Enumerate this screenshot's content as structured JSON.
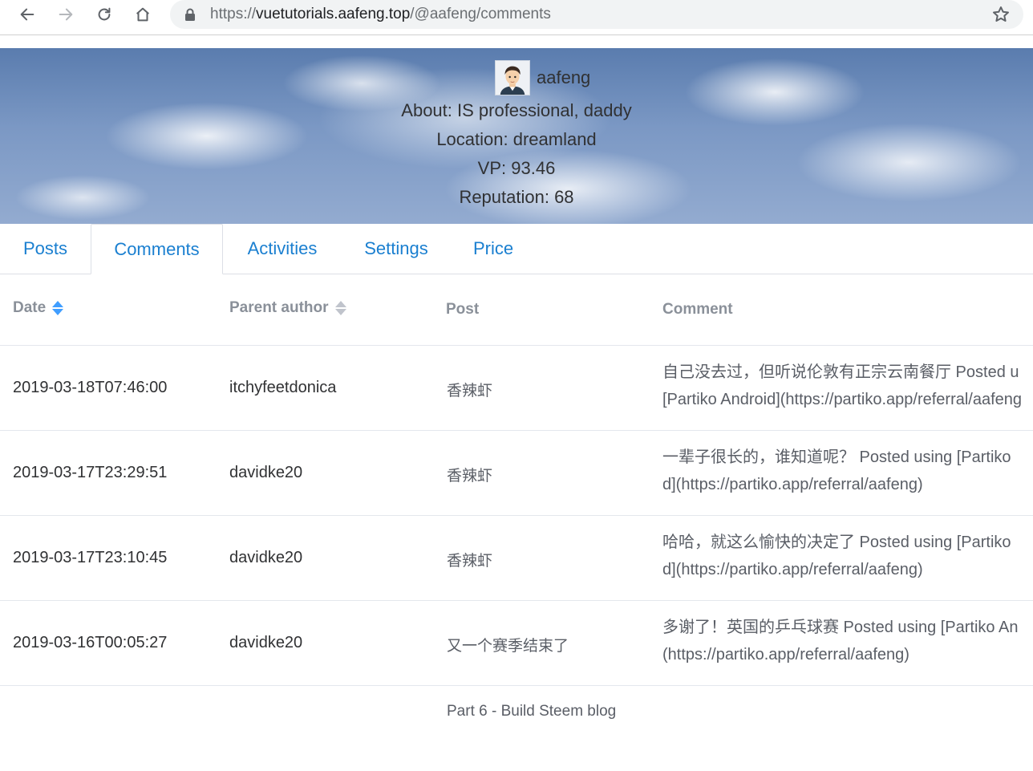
{
  "browser": {
    "url_protocol": "https://",
    "url_host": "vuetutorials.aafeng.top",
    "url_path": "/@aafeng/comments"
  },
  "profile": {
    "username": "aafeng",
    "about": "About: IS professional, daddy",
    "location": "Location: dreamland",
    "vp": "VP: 93.46",
    "reputation": "Reputation: 68"
  },
  "tabs": [
    {
      "label": "Posts"
    },
    {
      "label": "Comments"
    },
    {
      "label": "Activities"
    },
    {
      "label": "Settings"
    },
    {
      "label": "Price"
    }
  ],
  "active_tab": "Comments",
  "table": {
    "headers": {
      "date": "Date",
      "parent_author": "Parent author",
      "post": "Post",
      "comment": "Comment"
    },
    "rows": [
      {
        "date": "2019-03-18T07:46:00",
        "parent_author": "itchyfeetdonica",
        "post": "香辣虾",
        "comment_line1": "自己没去过，但听说伦敦有正宗云南餐厅 Posted u",
        "comment_line2": "[Partiko Android](https://partiko.app/referral/aafeng"
      },
      {
        "date": "2019-03-17T23:29:51",
        "parent_author": "davidke20",
        "post": "香辣虾",
        "comment_line1": "一辈子很长的，谁知道呢？ Posted using [Partiko",
        "comment_line2": "d](https://partiko.app/referral/aafeng)"
      },
      {
        "date": "2019-03-17T23:10:45",
        "parent_author": "davidke20",
        "post": "香辣虾",
        "comment_line1": "哈哈，就这么愉快的决定了 Posted using [Partiko",
        "comment_line2": "d](https://partiko.app/referral/aafeng)"
      },
      {
        "date": "2019-03-16T00:05:27",
        "parent_author": "davidke20",
        "post": "又一个赛季结束了",
        "comment_line1": "多谢了！英国的乒乓球赛 Posted using [Partiko An",
        "comment_line2": "(https://partiko.app/referral/aafeng)"
      },
      {
        "date": "",
        "parent_author": "",
        "post": "Part 6 - Build Steem blog",
        "comment_line1": "",
        "comment_line2": ""
      }
    ]
  },
  "colors": {
    "accent": "#1a7fd0",
    "sort_active": "#409eff"
  },
  "icons": [
    "back-icon",
    "forward-icon",
    "reload-icon",
    "home-icon",
    "lock-icon",
    "star-icon",
    "avatar",
    "sort-icon"
  ]
}
